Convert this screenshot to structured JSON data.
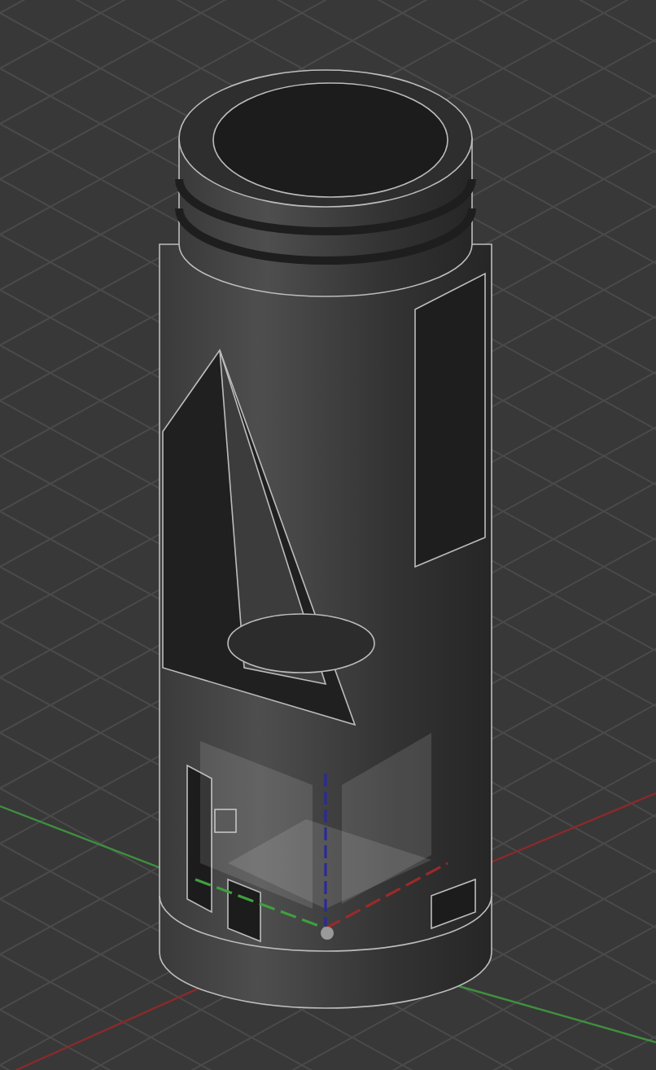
{
  "viewport": {
    "grid_visible": true,
    "origin_planes_visible": true
  }
}
